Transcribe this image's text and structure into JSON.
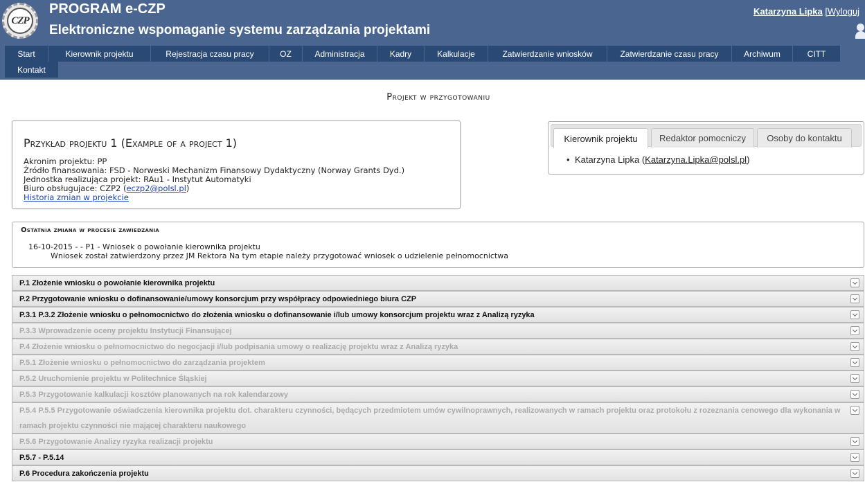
{
  "header": {
    "logo_text": "CZP",
    "title": "PROGRAM e-CZP",
    "subtitle": "Elektroniczne wspomaganie systemu zarządzania projektami",
    "user_name": "Katarzyna Lipka",
    "logout_label": "[Wyloguj"
  },
  "nav": [
    {
      "label": "Start"
    },
    {
      "label": "Kierownik projektu"
    },
    {
      "label": "Rejestracja czasu pracy"
    },
    {
      "label": "OZ"
    },
    {
      "label": "Administracja"
    },
    {
      "label": "Kadry"
    },
    {
      "label": "Kalkulacje"
    },
    {
      "label": "Zatwierdzanie wniosków"
    },
    {
      "label": "Zatwierdzanie czasu pracy"
    },
    {
      "label": "Archiwum"
    },
    {
      "label": "CITT"
    },
    {
      "label": "Kontakt"
    }
  ],
  "page_title": "Projekt w przygotowaniu",
  "project": {
    "name": "Przykład projektu 1 (Example of a project 1)",
    "acronym": "Akronim projektu: PP",
    "funding": "Źródło finansowania: FSD - Norweski Mechanizm Finansowy Dydaktyczny (Norway Grants Dyd.)",
    "unit": "Jednostka realizująca projekt: RAu1 - Instytut Automatyki",
    "office_prefix": "Biuro obsługujace: CZP2 (",
    "office_email": "eczp2@polsl.pl",
    "office_suffix": ")",
    "history_link": "Historia zmian w projekcie"
  },
  "tabs": [
    {
      "label": "Kierownik projektu",
      "active": true
    },
    {
      "label": "Redaktor pomocniczy",
      "active": false
    },
    {
      "label": "Osoby do kontaktu",
      "active": false
    }
  ],
  "contact": {
    "bullet": "•",
    "name": "Katarzyna Lipka (",
    "email": "Katarzyna.Lipka@polsl.pl",
    "suffix": ")"
  },
  "last_change": {
    "title": "Ostatnia zmiana w procesie zawiedzania",
    "entry": "16-10-2015 - - P1 - Wniosek o powołanie kierownika projektu",
    "description": "Wniosek został zatwierdzony przez JM Rektora Na tym etapie należy przygotować wniosek o udzielenie pełnomocnictwa"
  },
  "steps": [
    {
      "label": "P.1 Złożenie wniosku o powołanie kierownika projektu",
      "enabled": true
    },
    {
      "label": "P.2 Przygotowanie wniosku o dofinansowanie/umowy konsorcjum przy współpracy odpowiedniego biura CZP",
      "enabled": true
    },
    {
      "label": "P.3.1 P.3.2 Złożenie wniosku o pełnomocnictwo do złożenia wniosku o dofinansowanie i/lub umowy konsorcjum projektu wraz z Analizą ryzyka",
      "enabled": true
    },
    {
      "label": "P.3.3 Wprowadzenie oceny projektu Instytucji Finansującej",
      "enabled": false
    },
    {
      "label": "P.4 Złożenie wniosku o pełnomocnictwo do negocjacji i/lub podpisania umowy o realizację projektu wraz z Analizą ryzyka",
      "enabled": false
    },
    {
      "label": "P.5.1 Złożenie wniosku o pełnomocnictwo do zarządzania projektem",
      "enabled": false
    },
    {
      "label": "P.5.2 Uruchomienie projektu w Politechnice Śląskiej",
      "enabled": false
    },
    {
      "label": "P.5.3 Przygotowanie kalkulacji kosztów planowanych na rok kalendarzowy",
      "enabled": false
    },
    {
      "label": "P.5.4 P.5.5 Przygotowanie oświadczenia kierownika projektu dot. charakteru czynności, będących przedmiotem umów cywilnoprawnych, realizowanych w ramach projektu oraz protokołu z rozeznania cenowego dla wykonania w ramach projektu czynności nie mającej charakteru naukowego",
      "enabled": false
    },
    {
      "label": "P.5.6 Przygotowanie Analizy ryzyka realizacji projektu",
      "enabled": false
    },
    {
      "label": "P.5.7 - P.5.14",
      "enabled": true
    },
    {
      "label": "P.6 Procedura zakończenia projektu",
      "enabled": true
    }
  ]
}
